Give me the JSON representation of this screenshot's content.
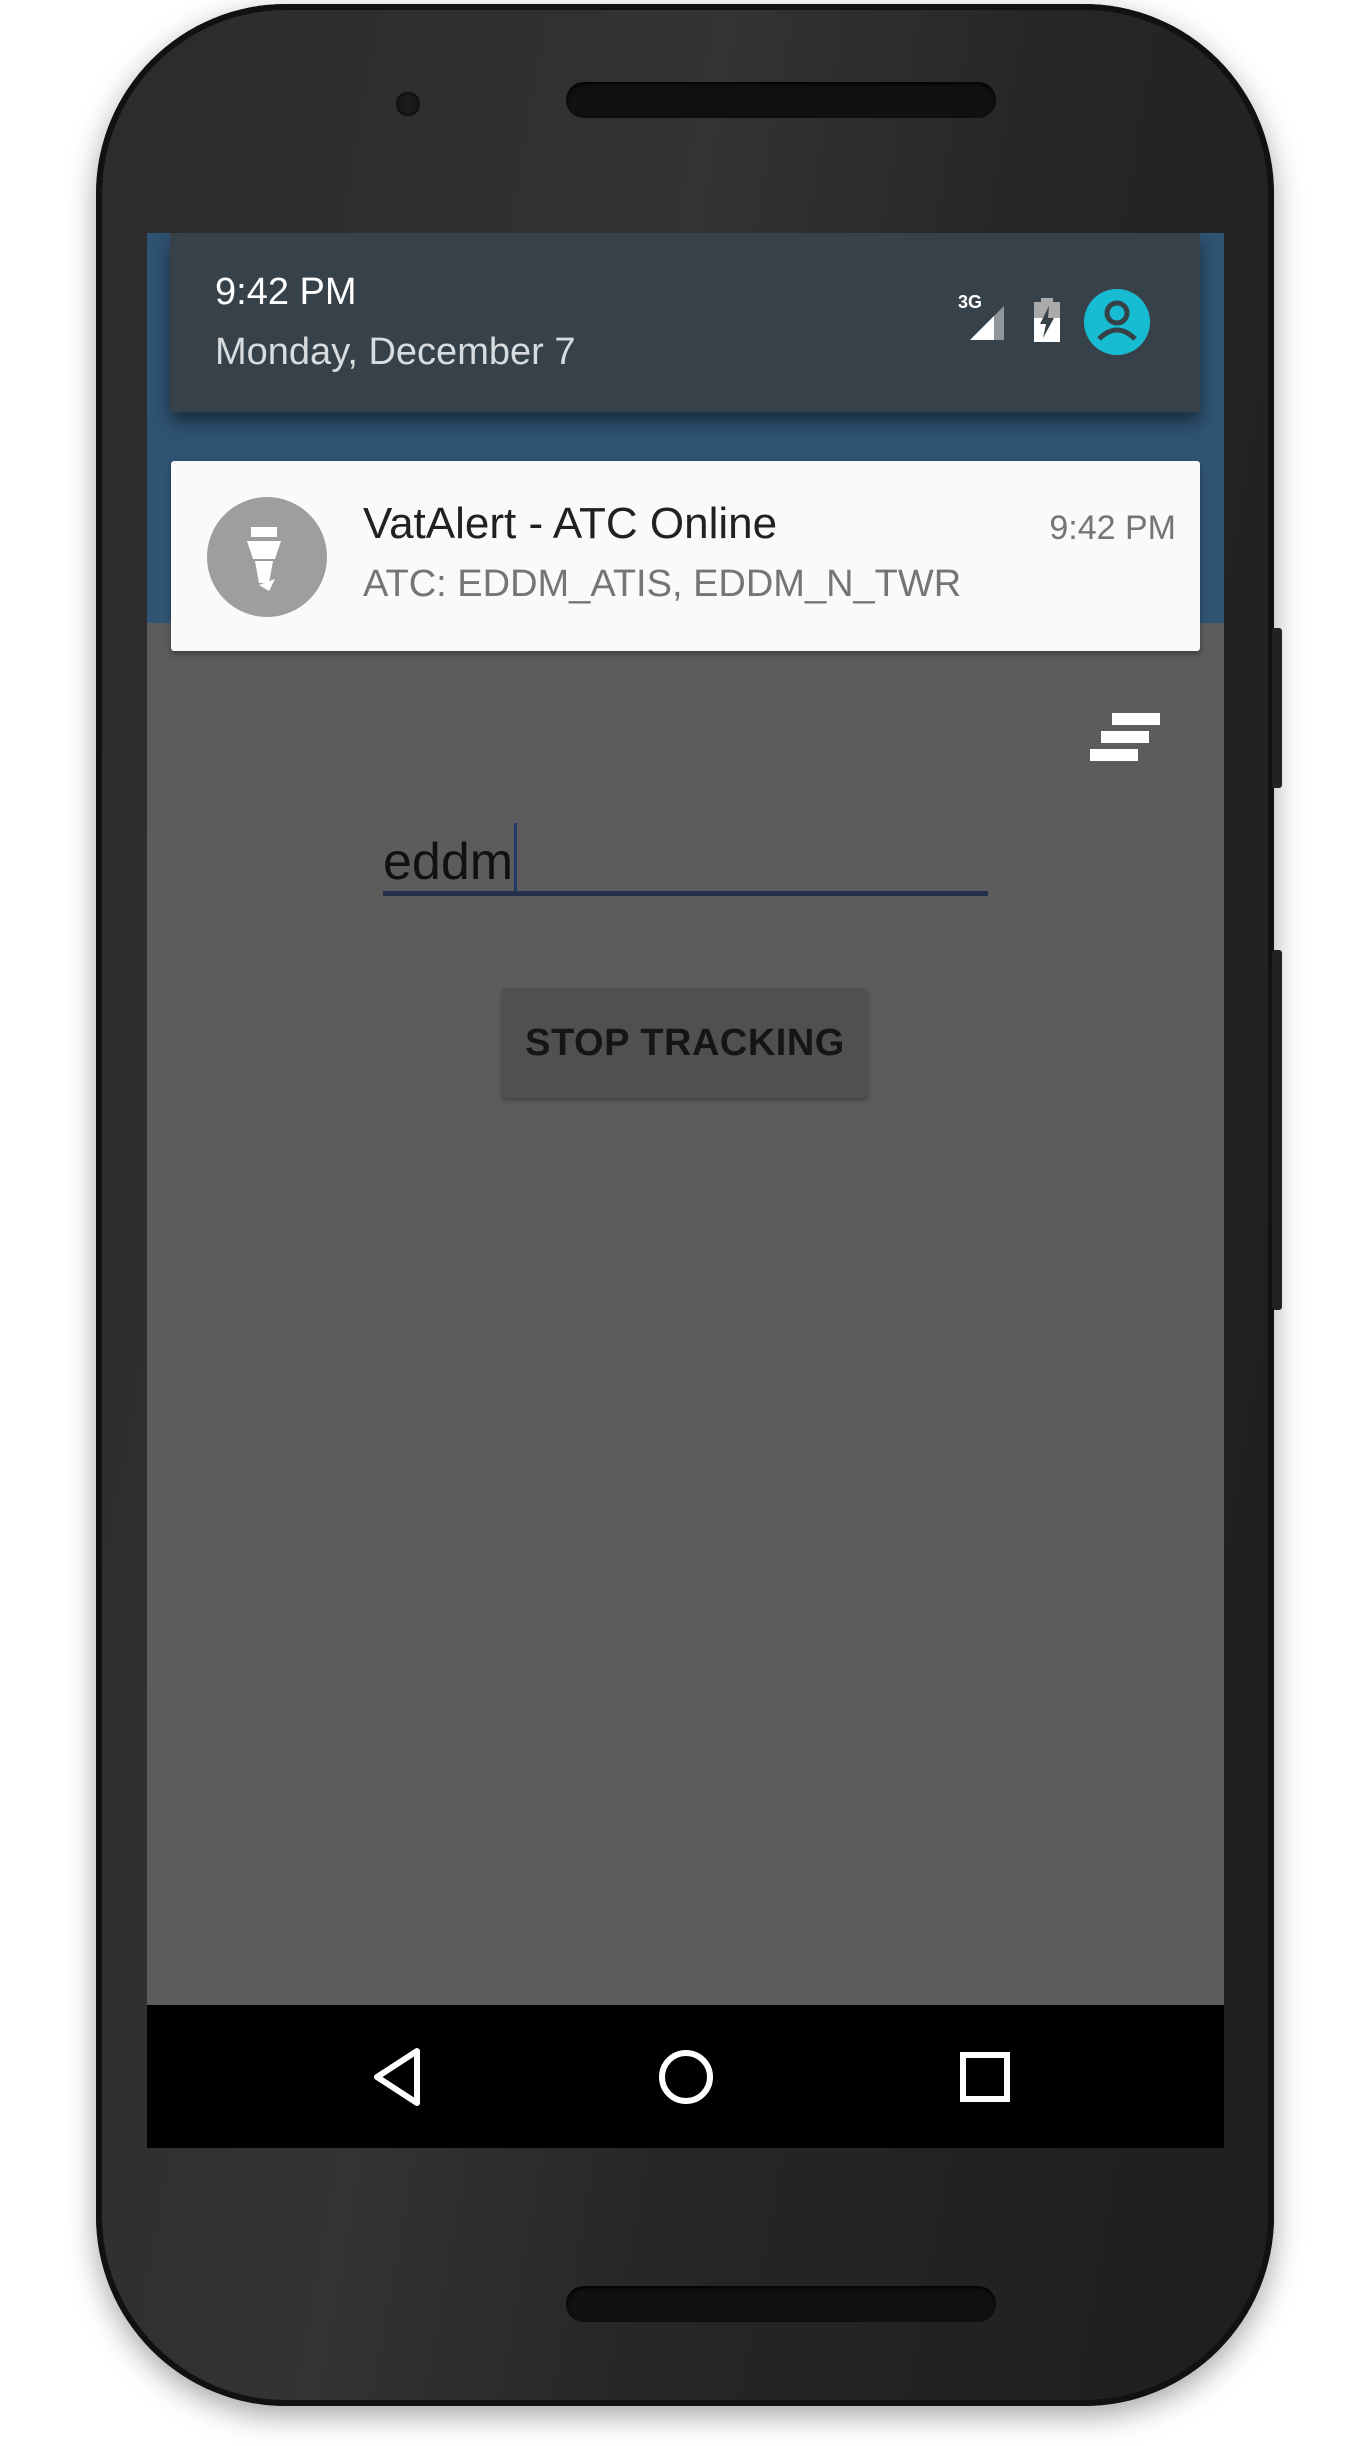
{
  "status": {
    "time": "9:42 PM",
    "date": "Monday, December 7",
    "network_label": "3G",
    "icons": [
      "signal-3g-icon",
      "battery-charging-icon",
      "user-avatar-icon"
    ],
    "accent": "#17bcd3"
  },
  "notification": {
    "app_icon": "control-tower-icon",
    "title": "VatAlert - ATC Online",
    "text": "ATC: EDDM_ATIS, EDDM_N_TWR",
    "time": "9:42 PM"
  },
  "app": {
    "menu_icon": "sort-list-icon",
    "airport_input_value": "eddm",
    "stop_button_label": "STOP TRACKING"
  },
  "navbar": {
    "icons": [
      "back-icon",
      "home-icon",
      "recents-icon"
    ]
  }
}
